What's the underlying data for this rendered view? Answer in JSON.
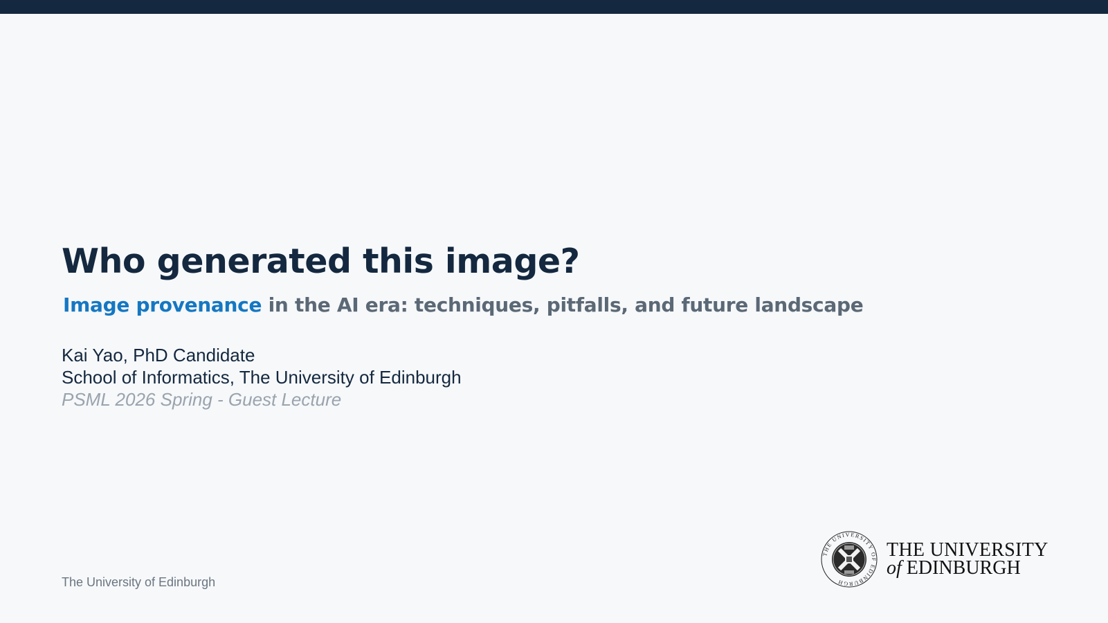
{
  "slide": {
    "title": "Who generated this image?",
    "subtitle_highlight": "Image provenance",
    "subtitle_rest": " in the AI era: techniques, pitfalls, and future landscape",
    "author": "Kai Yao, PhD Candidate",
    "affiliation": "School of Informatics, The University of Edinburgh",
    "event": "PSML 2026 Spring - Guest Lecture",
    "footer": "The University of Edinburgh"
  },
  "logo": {
    "wordmark_line1": "THE UNIVERSITY",
    "wordmark_of": "of",
    "wordmark_line2": " EDINBURGH",
    "crest_ring_text": "THE UNIVERSITY OF EDINBURGH"
  },
  "colors": {
    "top_bar": "#14283f",
    "background": "#f6f8fa",
    "title": "#14283f",
    "accent": "#1577c2",
    "subtitle": "#5b6875",
    "muted": "#9aa3ad"
  }
}
